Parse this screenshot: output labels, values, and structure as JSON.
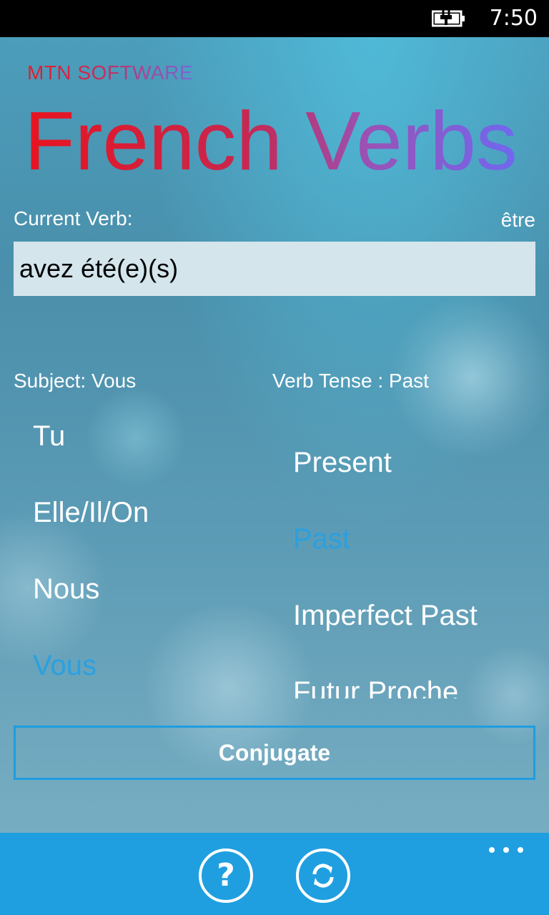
{
  "status": {
    "time": "7:50",
    "battery_icon": "battery-charging-icon"
  },
  "header": {
    "brand": "MTN SOFTWARE",
    "title": "French Verbs"
  },
  "current_verb": {
    "label": "Current Verb:",
    "verb": "être",
    "value": "avez été(e)(s)"
  },
  "subject": {
    "label": "Subject:  Vous",
    "items": [
      "Tu",
      "Elle/Il/On",
      "Nous",
      "Vous"
    ],
    "selected": "Vous"
  },
  "tense": {
    "label": "Verb Tense :  Past",
    "items": [
      "Present",
      "Past",
      "Imperfect Past",
      "Futur Proche"
    ],
    "selected": "Past"
  },
  "actions": {
    "conjugate": "Conjugate"
  },
  "appbar": {
    "help_icon": "question-icon",
    "refresh_icon": "refresh-icon",
    "more_icon": "more-icon",
    "help_glyph": "?"
  },
  "colors": {
    "accent": "#1f9fe0",
    "selected_text": "#2aa0e0"
  }
}
